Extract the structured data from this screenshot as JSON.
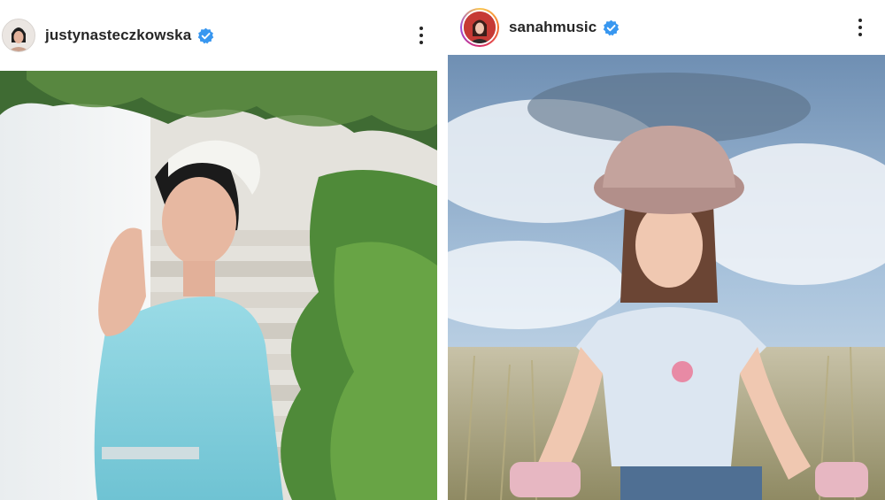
{
  "left_post": {
    "username": "justynasteczkowska",
    "verified": true,
    "avatar_icon": "profile-avatar",
    "menu_icon": "more-options-icon",
    "photo_icon": "post-photo"
  },
  "right_post": {
    "username": "sanahmusic",
    "verified": true,
    "has_story_ring": true,
    "avatar_icon": "profile-avatar",
    "menu_icon": "more-options-icon",
    "photo_icon": "post-photo"
  },
  "colors": {
    "verified_badge": "#3897f0",
    "username_text": "#262626",
    "story_ring": [
      "#f9c74f",
      "#f3722c",
      "#d62868",
      "#9d4edd"
    ],
    "dress": "#8fd3e0",
    "sky": "#8fb3d6"
  }
}
